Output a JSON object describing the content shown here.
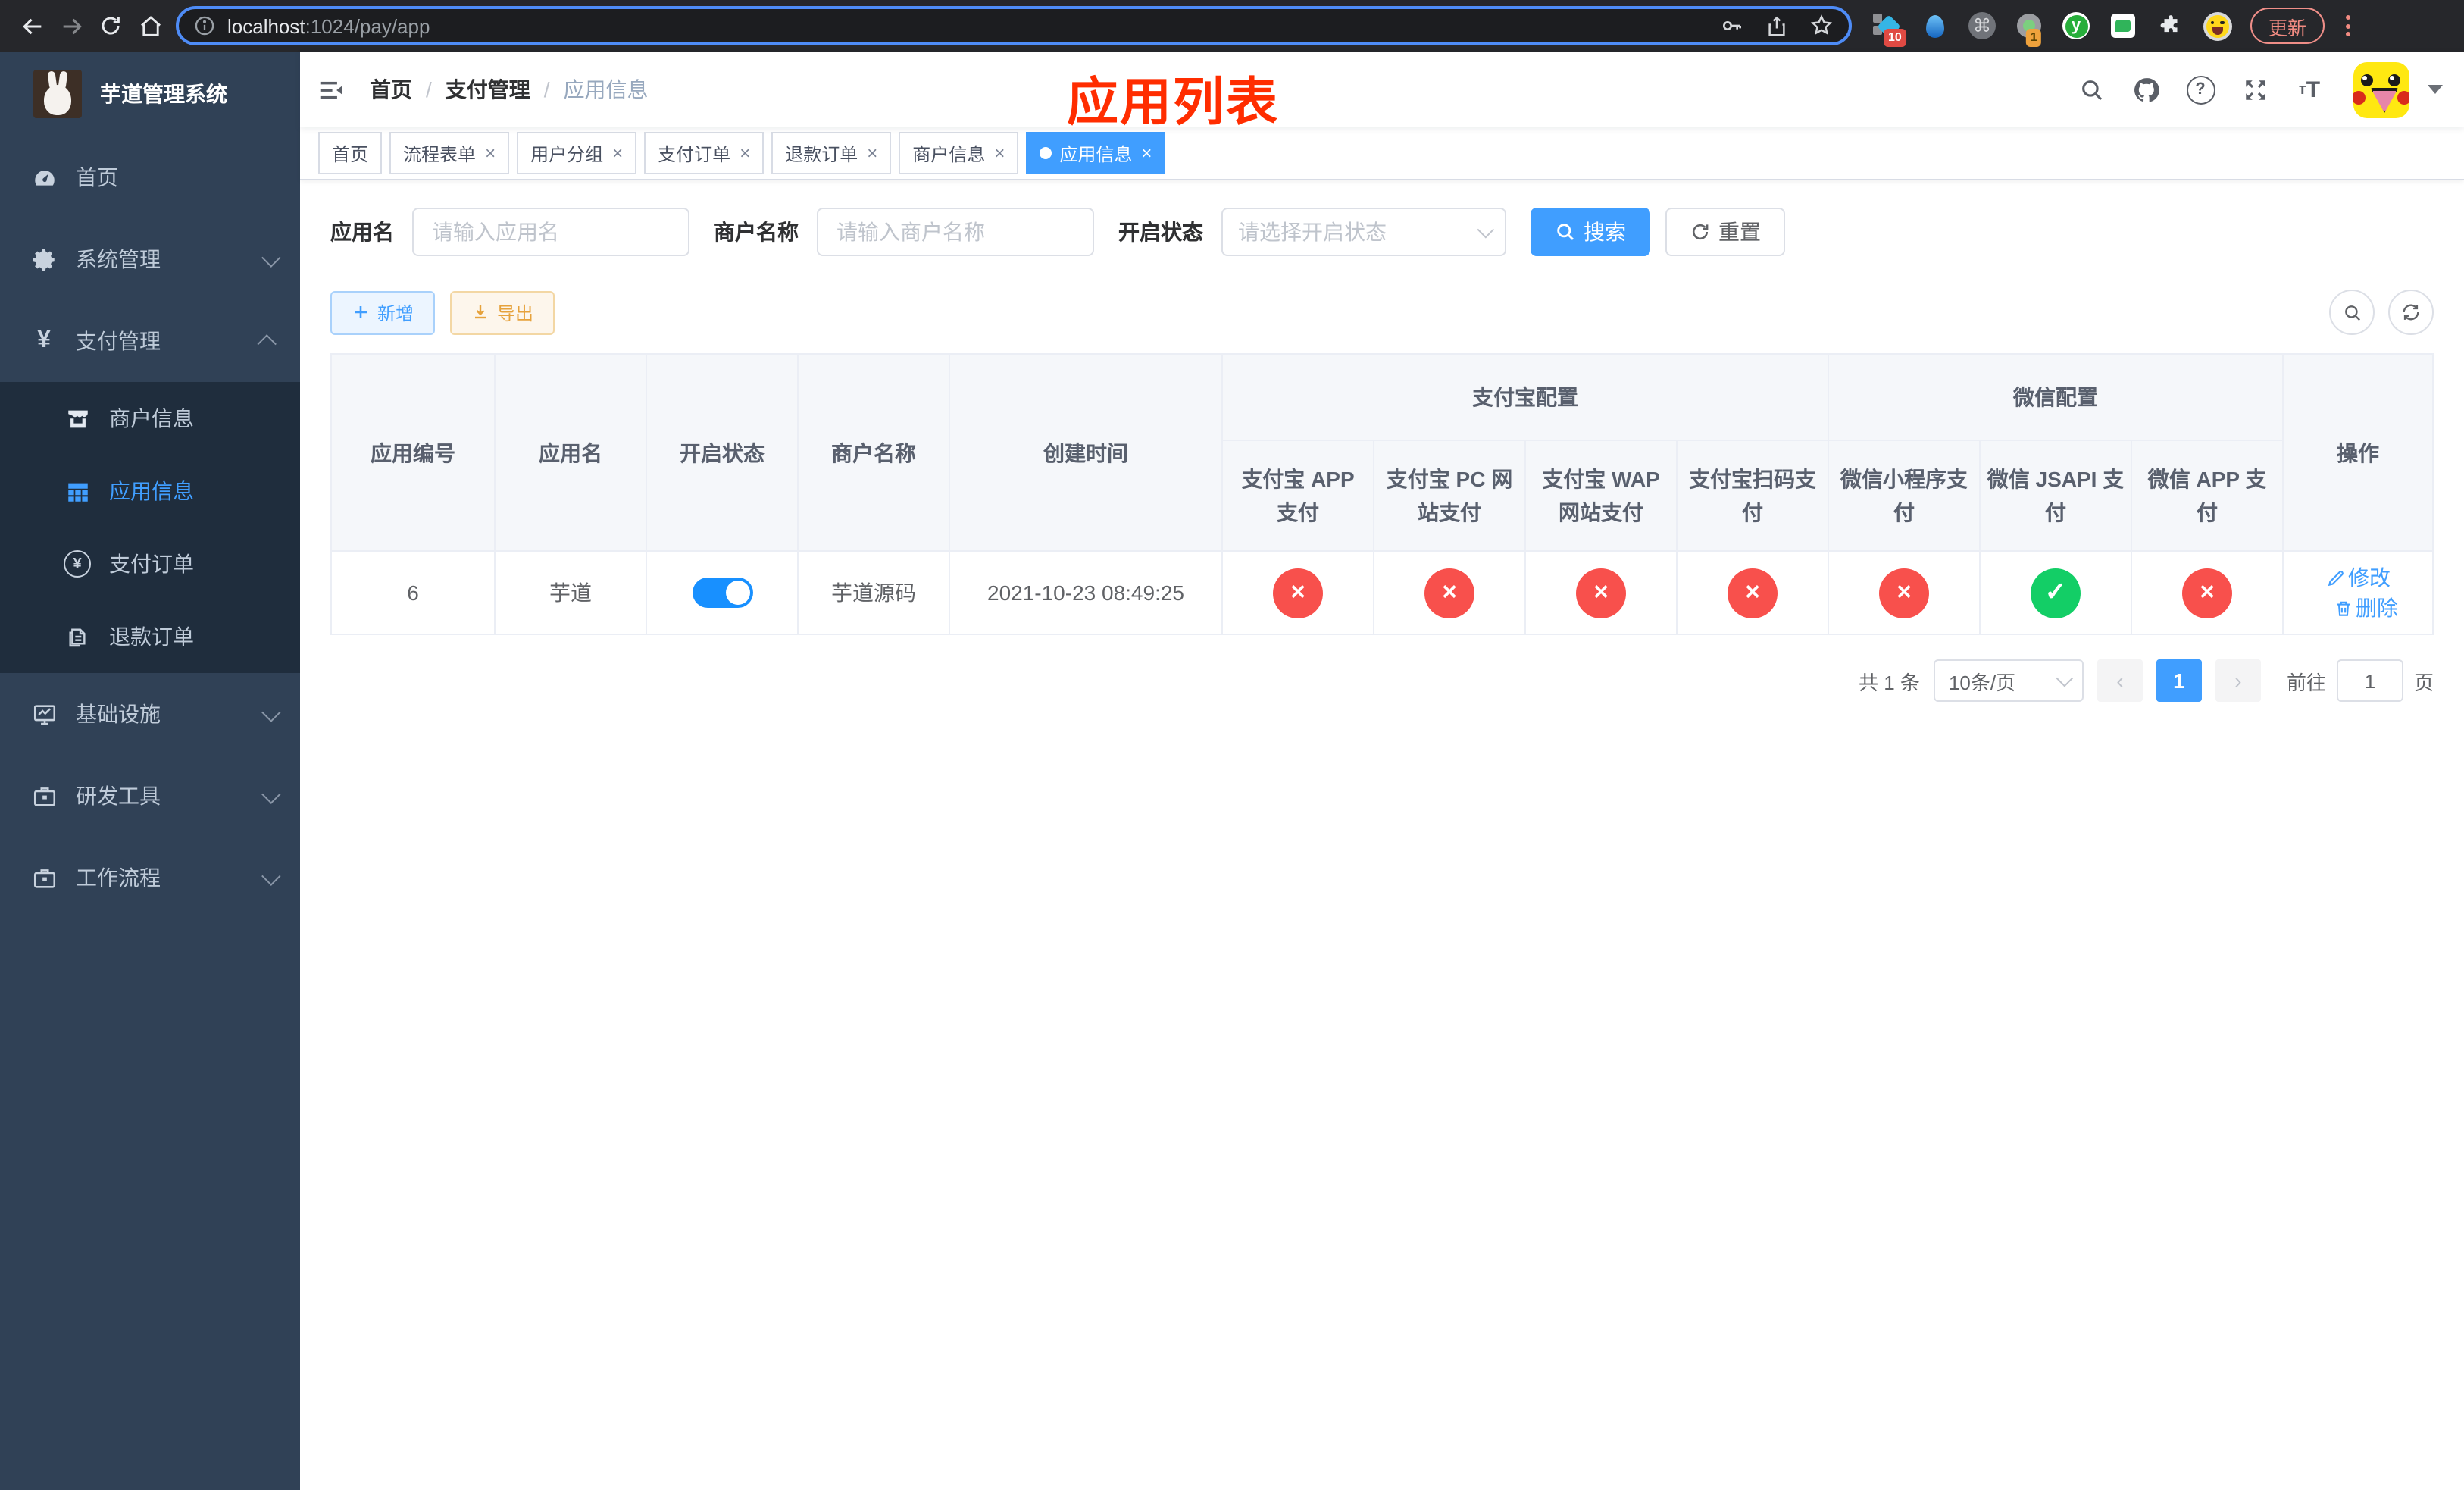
{
  "browser": {
    "url": {
      "host": "localhost",
      "rest": ":1024/pay/app"
    },
    "ext_badge_blue": "10",
    "ext_badge_circle": "1",
    "update_label": "更新"
  },
  "sidebar": {
    "title": "芋道管理系统",
    "items": [
      {
        "label": "首页",
        "icon": "dashboard-icon"
      },
      {
        "label": "系统管理",
        "icon": "gear-icon",
        "chevron": "down"
      },
      {
        "label": "支付管理",
        "icon": "yen-icon",
        "chevron": "up"
      },
      {
        "label": "商户信息",
        "icon": "shop-icon"
      },
      {
        "label": "应用信息",
        "icon": "grid-icon",
        "active": true
      },
      {
        "label": "支付订单",
        "icon": "coin-icon"
      },
      {
        "label": "退款订单",
        "icon": "document-icon"
      },
      {
        "label": "基础设施",
        "icon": "monitor-icon",
        "chevron": "down"
      },
      {
        "label": "研发工具",
        "icon": "toolbox-icon",
        "chevron": "down"
      },
      {
        "label": "工作流程",
        "icon": "workflow-icon",
        "chevron": "down"
      }
    ]
  },
  "navbar": {
    "breadcrumb": [
      "首页",
      "支付管理",
      "应用信息"
    ],
    "overlay_title": "应用列表"
  },
  "tags": [
    {
      "label": "首页",
      "closable": false,
      "active": false
    },
    {
      "label": "流程表单",
      "closable": true,
      "active": false
    },
    {
      "label": "用户分组",
      "closable": true,
      "active": false
    },
    {
      "label": "支付订单",
      "closable": true,
      "active": false
    },
    {
      "label": "退款订单",
      "closable": true,
      "active": false
    },
    {
      "label": "商户信息",
      "closable": true,
      "active": false
    },
    {
      "label": "应用信息",
      "closable": true,
      "active": true
    }
  ],
  "filter": {
    "app_name_label": "应用名",
    "app_name_placeholder": "请输入应用名",
    "merchant_label": "商户名称",
    "merchant_placeholder": "请输入商户名称",
    "status_label": "开启状态",
    "status_placeholder": "请选择开启状态",
    "search_label": "搜索",
    "reset_label": "重置"
  },
  "toolbar": {
    "add_label": "新增",
    "export_label": "导出"
  },
  "table": {
    "group_alipay": "支付宝配置",
    "group_wechat": "微信配置",
    "cols": [
      "应用编号",
      "应用名",
      "开启状态",
      "商户名称",
      "创建时间",
      "支付宝 APP 支付",
      "支付宝 PC 网站支付",
      "支付宝 WAP 网站支付",
      "支付宝扫码支付",
      "微信小程序支付",
      "微信 JSAPI 支付",
      "微信 APP 支付",
      "操作"
    ],
    "row": {
      "id": "6",
      "name": "芋道",
      "enabled": true,
      "merchant": "芋道源码",
      "created": "2021-10-23 08:49:25",
      "statuses": [
        "x",
        "x",
        "x",
        "x",
        "x",
        "check",
        "x"
      ],
      "edit_label": "修改",
      "delete_label": "删除"
    }
  },
  "pagination": {
    "total": "共 1 条",
    "page_size": "10条/页",
    "page": "1",
    "goto_label": "前往",
    "goto_value": "1",
    "unit_label": "页"
  }
}
